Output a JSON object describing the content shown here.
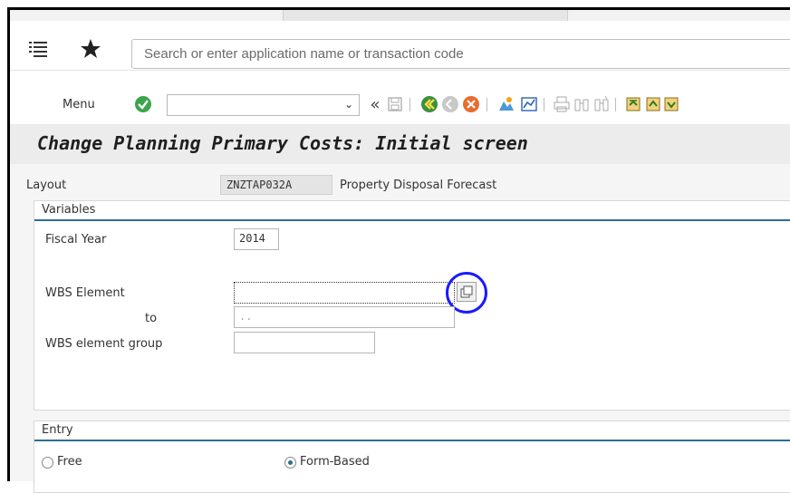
{
  "shell": {
    "search_placeholder": "Search or enter application name or transaction code"
  },
  "toolbar": {
    "menu_label": "Menu",
    "command_field_value": "",
    "icons": [
      "enter-check-icon",
      "dropdown-chevron-icon",
      "double-left-icon",
      "save-icon",
      "back-icon",
      "exit-icon",
      "cancel-icon",
      "layout-icon",
      "chart-icon",
      "print-icon",
      "find-icon",
      "find-next-icon",
      "first-page-icon",
      "previous-page-icon",
      "next-page-icon"
    ]
  },
  "title": "Change Planning Primary Costs: Initial screen",
  "layout": {
    "label": "Layout",
    "value": "ZNZTAP032A",
    "description": "Property Disposal Forecast"
  },
  "variables": {
    "section_title": "Variables",
    "fiscal_year_label": "Fiscal Year",
    "fiscal_year_value": "2014",
    "wbs_element_label": "WBS Element",
    "wbs_element_value": "",
    "to_label": "to",
    "wbs_to_value": "..",
    "wbs_group_label": "WBS element group",
    "wbs_group_value": ""
  },
  "entry": {
    "section_title": "Entry",
    "options": [
      {
        "label": "Free",
        "selected": false
      },
      {
        "label": "Form-Based",
        "selected": true
      }
    ]
  },
  "colors": {
    "accent": "#2f6e8e",
    "annotation_circle": "#1a1aff",
    "enter_green": "#3aa54a"
  }
}
